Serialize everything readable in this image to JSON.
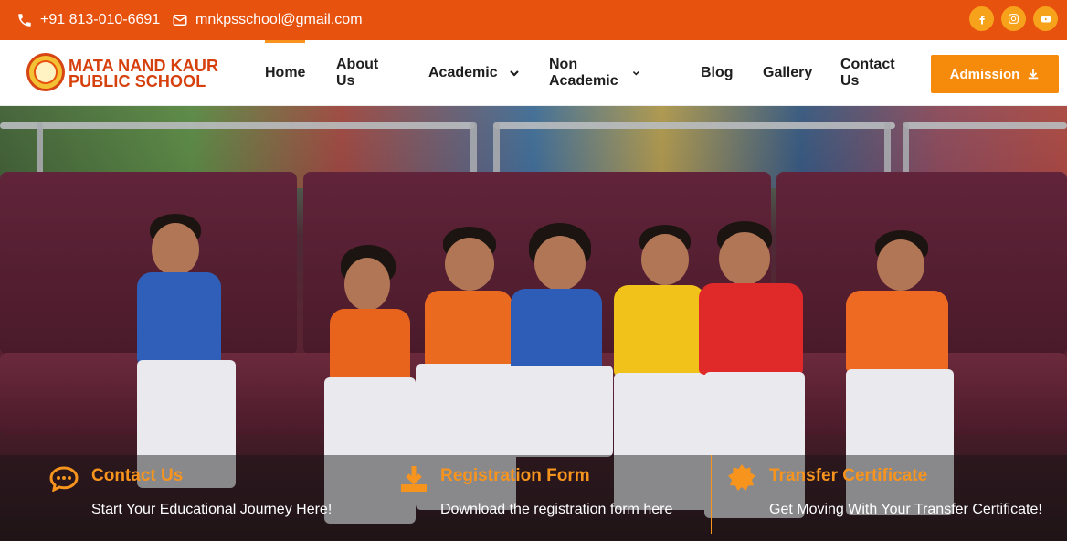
{
  "topbar": {
    "phone": "+91 813-010-6691",
    "email": "mnkpsschool@gmail.com",
    "socials": [
      {
        "icon": "facebook-icon",
        "label": "f"
      },
      {
        "icon": "instagram-icon",
        "label": ""
      },
      {
        "icon": "youtube-icon",
        "label": ""
      }
    ]
  },
  "header": {
    "brand_line1": "MATA NAND KAUR",
    "brand_line2": "PUBLIC SCHOOL",
    "nav": [
      {
        "label": "Home",
        "active": true
      },
      {
        "label": "About Us"
      },
      {
        "label": "Academic",
        "dropdown": true
      },
      {
        "label": "Non Academic",
        "dropdown": true
      },
      {
        "label": "Blog"
      },
      {
        "label": "Gallery"
      },
      {
        "label": "Contact Us"
      }
    ],
    "admission_label": "Admission"
  },
  "hero": {
    "features": [
      {
        "icon": "chat-bubble-icon",
        "title": "Contact Us",
        "subtitle": "Start Your Educational Journey Here!"
      },
      {
        "icon": "download-icon",
        "title": "Registration Form",
        "subtitle": "Download the registration form here"
      },
      {
        "icon": "badge-icon",
        "title": "Transfer Certificate",
        "subtitle": "Get Moving With Your Transfer Certificate!"
      }
    ]
  },
  "colors": {
    "topbar": "#e8520f",
    "accent": "#f7941d",
    "admission_button": "#f58a0b",
    "brand_text": "#d6400c"
  }
}
